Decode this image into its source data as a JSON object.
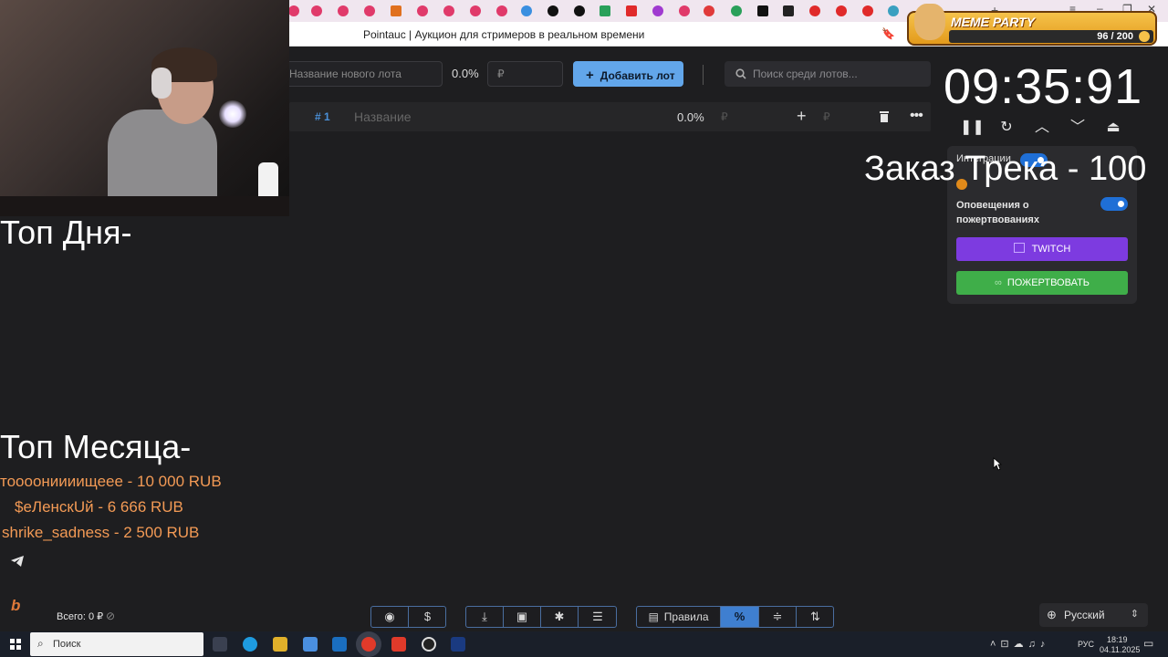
{
  "browser": {
    "page_title": "Pointauc | Аукцион для стримеров в реальном времени"
  },
  "toolbar": {
    "new_lot_placeholder": "Название нового лота",
    "percent": "0.0%",
    "currency": "₽",
    "add_lot_label": "Добавить лот",
    "search_placeholder": "Поиск среди лотов..."
  },
  "lot_row": {
    "number": "# 1",
    "name_placeholder": "Название",
    "percent": "0.0%",
    "currency": "₽",
    "currency2": "₽"
  },
  "overlays": {
    "top_day": "Топ Дня-",
    "top_month": "Топ Месяца-",
    "donors": [
      "тоооониииищеее - 10 000 RUB",
      "$еЛенскUй - 6 666 RUB",
      "shrike_sadness - 2 500 RUB"
    ],
    "track_order": "Заказ Трека - 100",
    "meme_party": "MEME PARTY",
    "meme_counter": "96 / 200"
  },
  "timer": {
    "value": "09:35:91"
  },
  "integrations": {
    "title": "Интеграции",
    "donation_alerts_label": "Оповещения о пожертвованиях",
    "twitch_label": "TWITCH",
    "donate_label": "ПОЖЕРТВОВАТЬ"
  },
  "bottom_bar": {
    "total": "Всего: 0 ₽",
    "rules_label": "Правила",
    "language": "Русский"
  },
  "taskbar": {
    "search_label": "Поиск",
    "lang": "РУС",
    "time": "18:19",
    "date": "04.11.2025"
  },
  "colors": {
    "accent_blue": "#62a6ea",
    "twitch_purple": "#7d3be0",
    "donate_green": "#3fae49",
    "donor_orange": "#f39a55"
  }
}
